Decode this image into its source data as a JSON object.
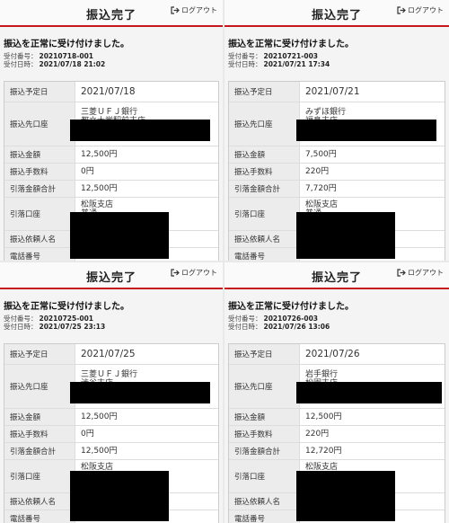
{
  "panels": [
    {
      "title": "振込完了",
      "logout_label": "ログアウト",
      "message": "振込を正常に受け付けました。",
      "receipt_no_label": "受付番号：",
      "receipt_no": "20210718-001",
      "receipt_dt_label": "受付日時：",
      "receipt_dt": "2021/07/18 21:02",
      "date_label": "振込予定日",
      "date": "2021/07/18",
      "dest_label": "振込先口座",
      "dest_bank": "三菱ＵＦＪ銀行",
      "dest_branch": "都立大学駅前支店",
      "amount_label": "振込金額",
      "amount": "12,500円",
      "fee_label": "振込手数料",
      "fee": "0円",
      "total_label": "引落金額合計",
      "total": "12,500円",
      "debit_label": "引落口座",
      "debit_branch": "松阪支店",
      "debit_type": "普通",
      "requester_label": "振込依頼人名",
      "phone_label": "電話番号"
    },
    {
      "title": "振込完了",
      "logout_label": "ログアウト",
      "message": "振込を正常に受け付けました。",
      "receipt_no_label": "受付番号：",
      "receipt_no": "20210721-003",
      "receipt_dt_label": "受付日時：",
      "receipt_dt": "2021/07/21 17:34",
      "date_label": "振込予定日",
      "date": "2021/07/21",
      "dest_label": "振込先口座",
      "dest_bank": "みずほ銀行",
      "dest_branch": "福島支店",
      "amount_label": "振込金額",
      "amount": "7,500円",
      "fee_label": "振込手数料",
      "fee": "220円",
      "total_label": "引落金額合計",
      "total": "7,720円",
      "debit_label": "引落口座",
      "debit_branch": "松阪支店",
      "debit_type": "普通",
      "requester_label": "振込依頼人名",
      "phone_label": "電話番号"
    },
    {
      "title": "振込完了",
      "logout_label": "ログアウト",
      "message": "振込を正常に受け付けました。",
      "receipt_no_label": "受付番号：",
      "receipt_no": "20210725-001",
      "receipt_dt_label": "受付日時：",
      "receipt_dt": "2021/07/25 23:13",
      "date_label": "振込予定日",
      "date": "2021/07/25",
      "dest_label": "振込先口座",
      "dest_bank": "三菱ＵＦＪ銀行",
      "dest_branch": "渋谷支店",
      "amount_label": "振込金額",
      "amount": "12,500円",
      "fee_label": "振込手数料",
      "fee": "0円",
      "total_label": "引落金額合計",
      "total": "12,500円",
      "debit_label": "引落口座",
      "debit_branch": "松阪支店",
      "debit_type": "普通",
      "requester_label": "振込依頼人名",
      "phone_label": "電話番号"
    },
    {
      "title": "振込完了",
      "logout_label": "ログアウト",
      "message": "振込を正常に受け付けました。",
      "receipt_no_label": "受付番号：",
      "receipt_no": "20210726-003",
      "receipt_dt_label": "受付日時：",
      "receipt_dt": "2021/07/26 13:06",
      "date_label": "振込予定日",
      "date": "2021/07/26",
      "dest_label": "振込先口座",
      "dest_bank": "岩手銀行",
      "dest_branch": "松園支店",
      "amount_label": "振込金額",
      "amount": "12,500円",
      "fee_label": "振込手数料",
      "fee": "220円",
      "total_label": "引落金額合計",
      "total": "12,720円",
      "debit_label": "引落口座",
      "debit_branch": "松阪支店",
      "debit_type": "普通",
      "requester_label": "振込依頼人名",
      "phone_label": "電話番号"
    }
  ]
}
